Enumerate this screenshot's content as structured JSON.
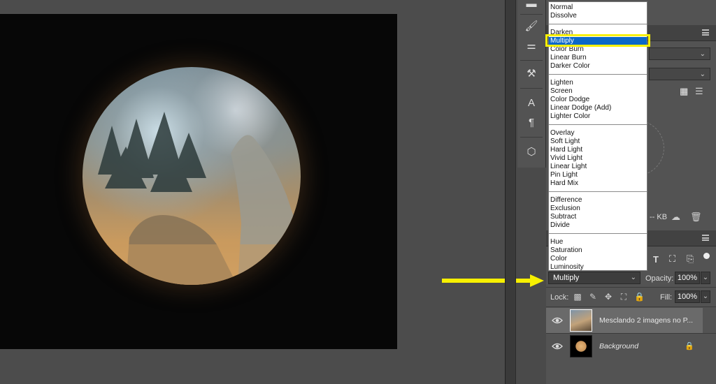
{
  "blend_modes": {
    "items": [
      {
        "label": "Normal"
      },
      {
        "label": "Dissolve"
      },
      {
        "label": "Darken"
      },
      {
        "label": "Multiply",
        "selected": true
      },
      {
        "label": "Color Burn"
      },
      {
        "label": "Linear Burn"
      },
      {
        "label": "Darker Color"
      },
      {
        "label": "Lighten"
      },
      {
        "label": "Screen"
      },
      {
        "label": "Color Dodge"
      },
      {
        "label": "Linear Dodge (Add)"
      },
      {
        "label": "Lighter Color"
      },
      {
        "label": "Overlay"
      },
      {
        "label": "Soft Light"
      },
      {
        "label": "Hard Light"
      },
      {
        "label": "Vivid Light"
      },
      {
        "label": "Linear Light"
      },
      {
        "label": "Pin Light"
      },
      {
        "label": "Hard Mix"
      },
      {
        "label": "Difference"
      },
      {
        "label": "Exclusion"
      },
      {
        "label": "Subtract"
      },
      {
        "label": "Divide"
      },
      {
        "label": "Hue"
      },
      {
        "label": "Saturation"
      },
      {
        "label": "Color"
      },
      {
        "label": "Luminosity"
      }
    ],
    "current": "Multiply"
  },
  "layers_panel": {
    "opacity_label": "Opacity:",
    "opacity_value": "100%",
    "lock_label": "Lock:",
    "fill_label": "Fill:",
    "fill_value": "100%",
    "layers": [
      {
        "name": "Mesclando 2 imagens no P...",
        "visible": true,
        "active": true
      },
      {
        "name": "Background",
        "visible": true,
        "locked": true
      }
    ]
  },
  "libraries": {
    "size_text": "-- KB"
  },
  "icons": {
    "tools": [
      "brush-preset-icon",
      "clone-source-icon",
      "tool-preset-icon",
      "character-icon",
      "paragraph-icon",
      "3d-cube-icon"
    ],
    "annotation_arrow": "yellow-arrow-icon"
  },
  "colors": {
    "highlight": "#f7f000",
    "selected_item": "#0b68c8",
    "arrow": "#f7f000"
  }
}
